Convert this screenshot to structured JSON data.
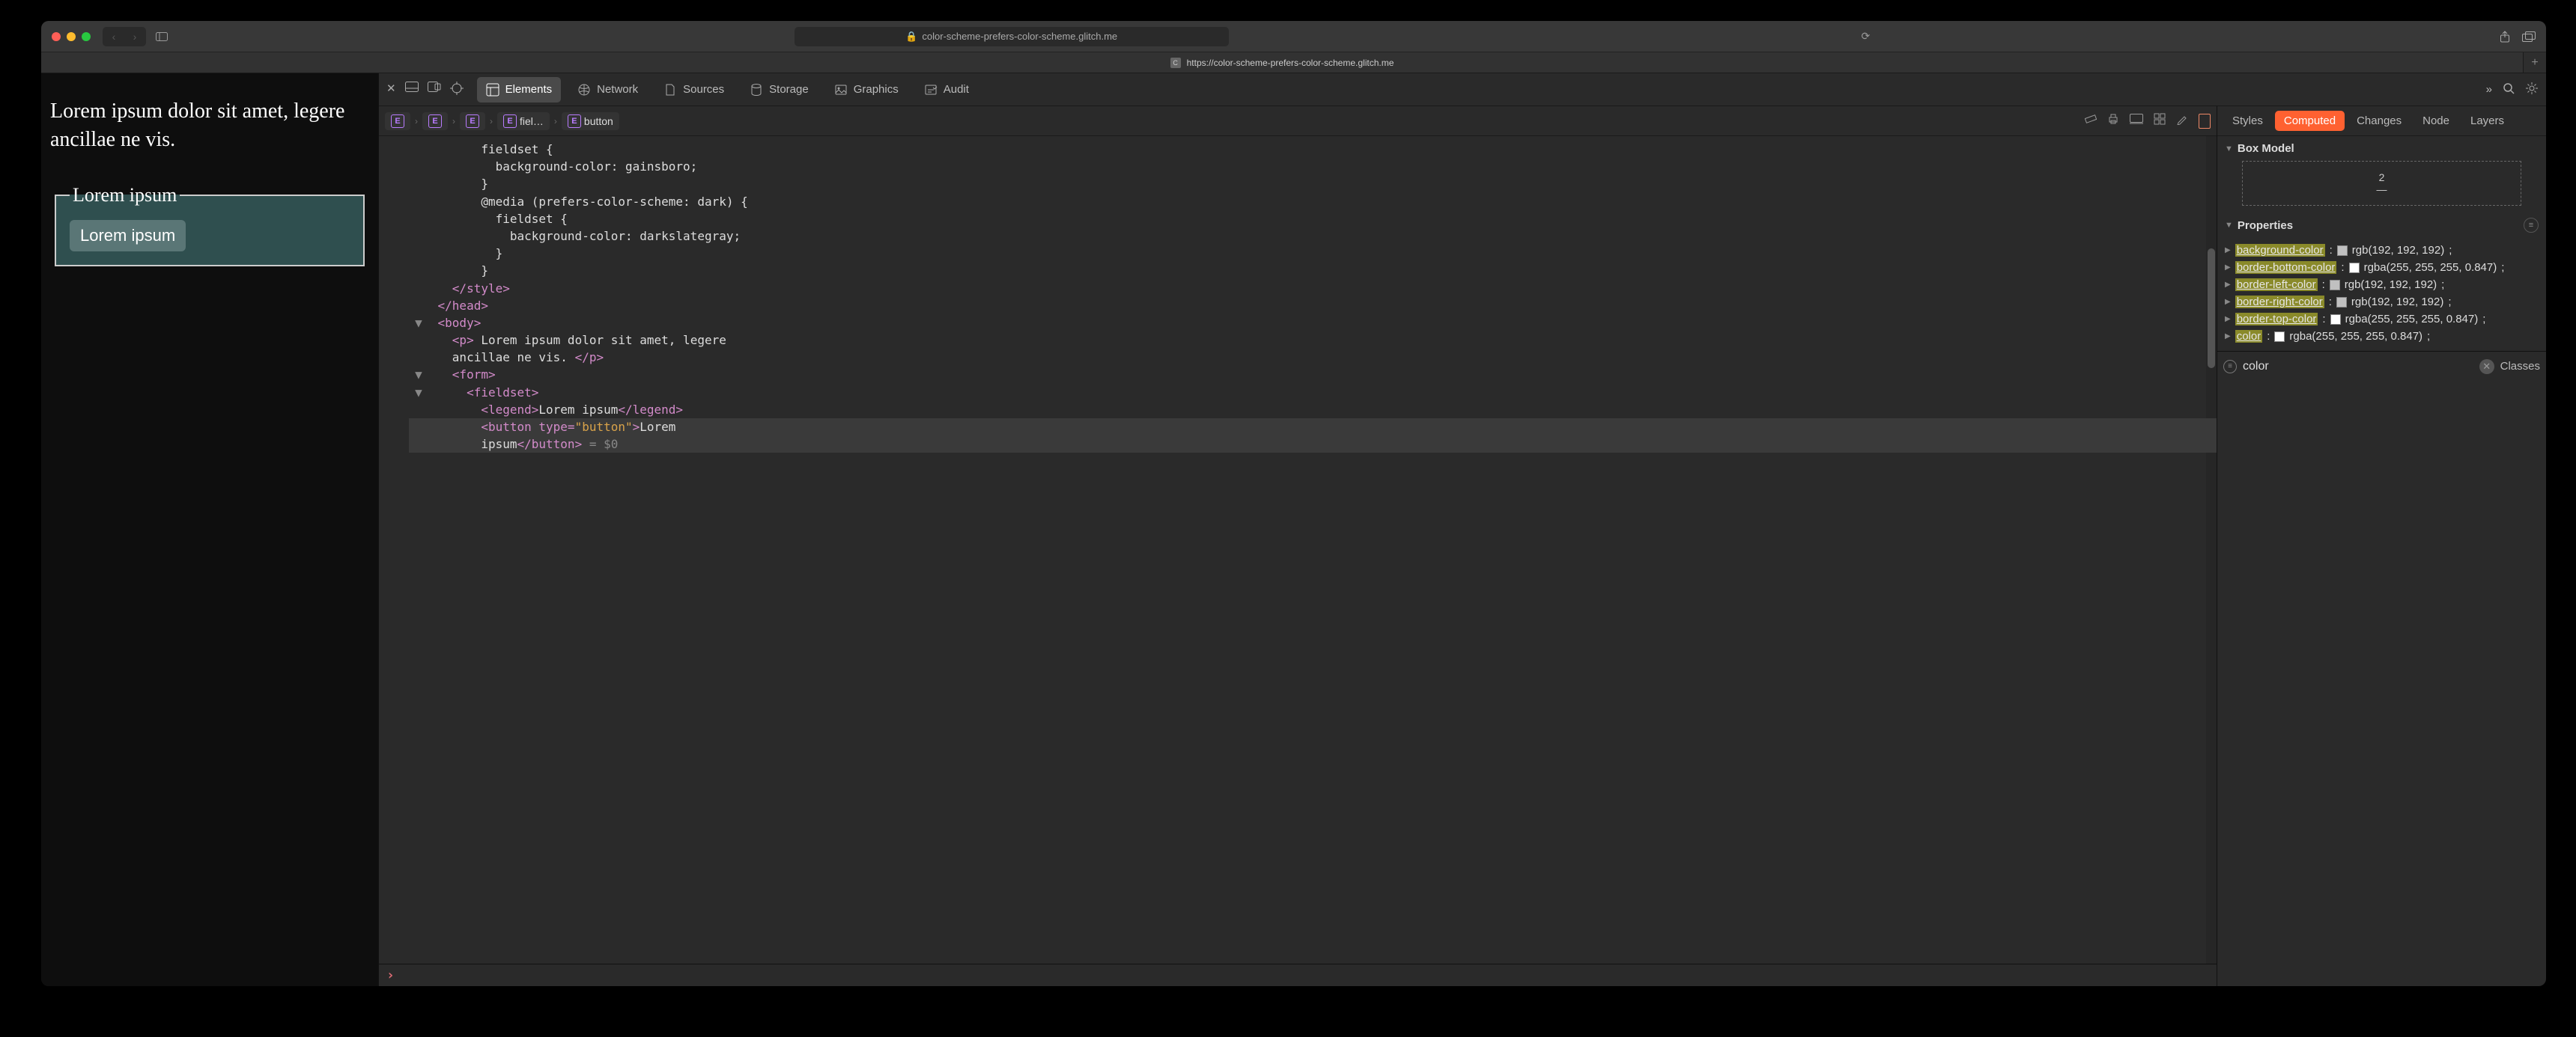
{
  "window": {
    "url_display": "color-scheme-prefers-color-scheme.glitch.me",
    "lock_icon": "lock",
    "tab_url": "https://color-scheme-prefers-color-scheme.glitch.me"
  },
  "page": {
    "paragraph": "Lorem ipsum dolor sit amet, legere ancillae ne vis.",
    "legend": "Lorem ipsum",
    "button": "Lorem ipsum"
  },
  "devtools": {
    "tabs": [
      "Elements",
      "Network",
      "Sources",
      "Storage",
      "Graphics",
      "Audit"
    ],
    "active_tab": "Elements",
    "breadcrumb": [
      "",
      "",
      "",
      "fiel…",
      "button"
    ],
    "code_lines": [
      {
        "indent": 5,
        "tw": "",
        "raw": "fieldset {"
      },
      {
        "indent": 6,
        "tw": "",
        "raw": "background-color: gainsboro;"
      },
      {
        "indent": 5,
        "tw": "",
        "raw": "}"
      },
      {
        "indent": 5,
        "tw": "",
        "raw": "@media (prefers-color-scheme: dark) {"
      },
      {
        "indent": 6,
        "tw": "",
        "raw": "fieldset {"
      },
      {
        "indent": 7,
        "tw": "",
        "raw": "background-color: darkslategray;"
      },
      {
        "indent": 6,
        "tw": "",
        "raw": "}"
      },
      {
        "indent": 5,
        "tw": "",
        "raw": "}"
      },
      {
        "indent": 3,
        "tw": "",
        "tag_close": "style"
      },
      {
        "indent": 2,
        "tw": "",
        "tag_close": "head"
      },
      {
        "indent": 2,
        "tw": "▼",
        "tag_open": "body"
      },
      {
        "indent": 3,
        "tw": "",
        "tag_open": "p",
        "text": " Lorem ipsum dolor sit amet, legere"
      },
      {
        "indent": 3,
        "tw": "",
        "text": "ancillae ne vis. ",
        "tag_close_inline": "p"
      },
      {
        "indent": 3,
        "tw": "▼",
        "tag_open": "form"
      },
      {
        "indent": 4,
        "tw": "▼",
        "tag_open": "fieldset"
      },
      {
        "indent": 5,
        "tw": "",
        "tag_open": "legend",
        "text": "Lorem ipsum",
        "tag_close_inline": "legend"
      },
      {
        "indent": 5,
        "tw": "",
        "selected": true,
        "tag_open": "button",
        "attr": "type",
        "val": "button",
        "text": "Lorem"
      },
      {
        "indent": 5,
        "tw": "",
        "selected": true,
        "text": "ipsum",
        "tag_close_inline": "button",
        "after": " = $0"
      }
    ],
    "sidebar": {
      "tabs": [
        "Styles",
        "Computed",
        "Changes",
        "Node",
        "Layers"
      ],
      "active": "Computed",
      "box_model_label": "Box Model",
      "box_model": {
        "top": "2",
        "value": "—"
      },
      "properties_label": "Properties",
      "props": [
        {
          "name": "background-color",
          "hl": true,
          "swatch": "#c0c0c0",
          "value": "rgb(192, 192, 192)"
        },
        {
          "name": "border-bottom-color",
          "hl": true,
          "swatch": "#ffffff",
          "value": "rgba(255, 255, 255, 0.847)"
        },
        {
          "name": "border-left-color",
          "hl": true,
          "swatch": "#c0c0c0",
          "value": "rgb(192, 192, 192)"
        },
        {
          "name": "border-right-color",
          "hl": true,
          "swatch": "#c0c0c0",
          "value": "rgb(192, 192, 192)"
        },
        {
          "name": "border-top-color",
          "hl": true,
          "swatch": "#ffffff",
          "value": "rgba(255, 255, 255, 0.847)"
        },
        {
          "name": "color",
          "hl": true,
          "swatch": "#ffffff",
          "value": "rgba(255, 255, 255, 0.847)"
        }
      ],
      "filter_value": "color",
      "classes_label": "Classes"
    }
  }
}
